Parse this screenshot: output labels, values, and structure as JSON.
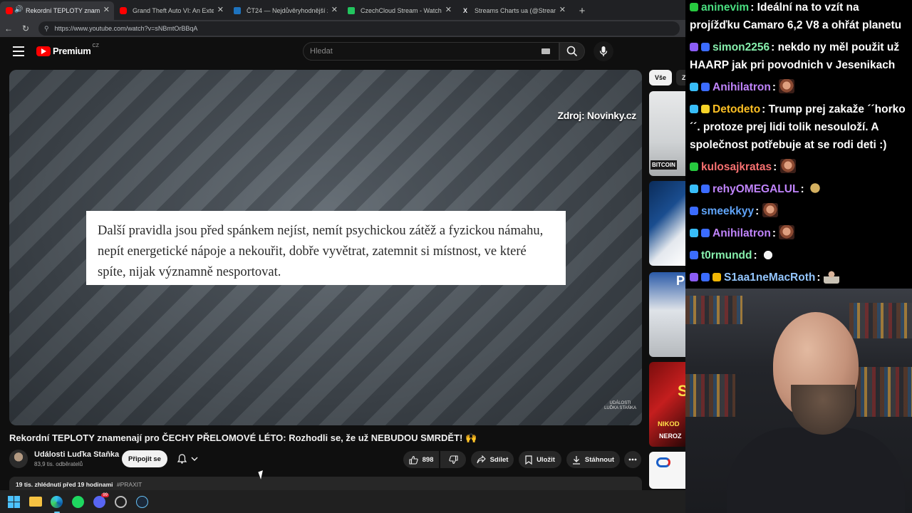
{
  "browser": {
    "tabs": [
      {
        "label": "Rekordní TEPLOTY znamenají",
        "favicon": "youtube-icon",
        "active": true
      },
      {
        "label": "Grand Theft Auto VI: An Extended",
        "favicon": "youtube-icon",
        "active": false
      },
      {
        "label": "ČT24 — Nejdůvěryhodnější zprav",
        "favicon": "ct24-icon",
        "active": false
      },
      {
        "label": "CzechCloud Stream - Watch Live o",
        "favicon": "kick-icon",
        "active": false
      },
      {
        "label": "Streams Charts ua (@StreamsChar",
        "favicon": "x-icon",
        "active": false
      }
    ],
    "url": "https://www.youtube.com/watch?v=sNBmtOrBBqA"
  },
  "youtube": {
    "brand": "Premium",
    "country": "CZ",
    "search_placeholder": "Hledat"
  },
  "video": {
    "source_label": "Zdroj: Novinky.cz",
    "caption": "Další pravidla jsou před spánkem nejíst, nemít psychickou zátěž a fyzickou námahu, nepít energetické nápoje a nekouřit, dobře vyvětrat, zatemnit si místnost, ve které spíte, nijak významně nesportovat.",
    "watermark_line1": "UDÁLOSTI",
    "watermark_line2": "LUĎKA STAŇKA",
    "title": "Rekordní TEPLOTY znamenají pro ČECHY PŘELOMOVÉ LÉTO: Rozhodli se, že už NEBUDOU SMRDĚT! 🙌",
    "channel_name": "Události Luďka Staňka",
    "subscribers": "83,9 tis. odběratelů",
    "subscribe_label": "Připojit se",
    "likes": "898",
    "share_label": "Sdílet",
    "save_label": "Uložit",
    "download_label": "Stáhnout",
    "views_time": "19 tis. zhlédnutí  před 19 hodinami",
    "hashtag": "#PRAXIT"
  },
  "sidebar": {
    "chip_all": "Vše",
    "chip_next": "Z",
    "thumb1_text": "BITCOIN",
    "thumb3_text": "P",
    "thumb4_big": "S",
    "thumb4_line1": "NIKOD",
    "thumb4_line2": "NEROZ"
  },
  "chat": {
    "messages": [
      {
        "user": "aninevim",
        "user_color": "#4ade80",
        "text": "Ideální na to vzít na projížďku Camaro 6,2 V8 a ohřát planetu",
        "badges": [
          "green"
        ]
      },
      {
        "user": "simon2256",
        "user_color": "#86efac",
        "text": "nekdo ny měl použit už HAARP jak pri povodnich v Jesenikach",
        "badges": [
          "purple",
          "blue"
        ]
      },
      {
        "user": "Anihilatron",
        "user_color": "#c084fc",
        "text": "",
        "badges": [
          "cyan",
          "blue"
        ],
        "emote": "face"
      },
      {
        "user": "Detodeto",
        "user_color": "#fbbf24",
        "text": "Trump prej zakaže ´´horko´´. protoze prej lidi tolik nesouloží. A společnost potřebuje at se rodi deti :)",
        "badges": [
          "cyan",
          "yellow"
        ]
      },
      {
        "user": "kulosajkratas",
        "user_color": "#f87171",
        "text": "",
        "badges": [
          "green"
        ],
        "emote": "face"
      },
      {
        "user": "rehyOMEGALUL",
        "user_color": "#c084fc",
        "text": "",
        "badges": [
          "cyan",
          "blue"
        ],
        "emote": "bear"
      },
      {
        "user": "smeekkyy",
        "user_color": "#60a5fa",
        "text": "",
        "badges": [
          "blue"
        ],
        "emote": "face"
      },
      {
        "user": "Anihilatron",
        "user_color": "#c084fc",
        "text": "",
        "badges": [
          "cyan",
          "blue"
        ],
        "emote": "face"
      },
      {
        "user": "t0rmundd",
        "user_color": "#86efac",
        "text": "",
        "badges": [
          "blue"
        ],
        "emote": "hand"
      },
      {
        "user": "S1aa1neMacRoth",
        "user_color": "#93c5fd",
        "text": "",
        "badges": [
          "purple",
          "blue",
          "gold"
        ],
        "emote": "man"
      }
    ]
  },
  "colors": {
    "yt_red": "#ff0000",
    "background": "#0f0f0f",
    "chip_active": "#f1f1f1"
  }
}
